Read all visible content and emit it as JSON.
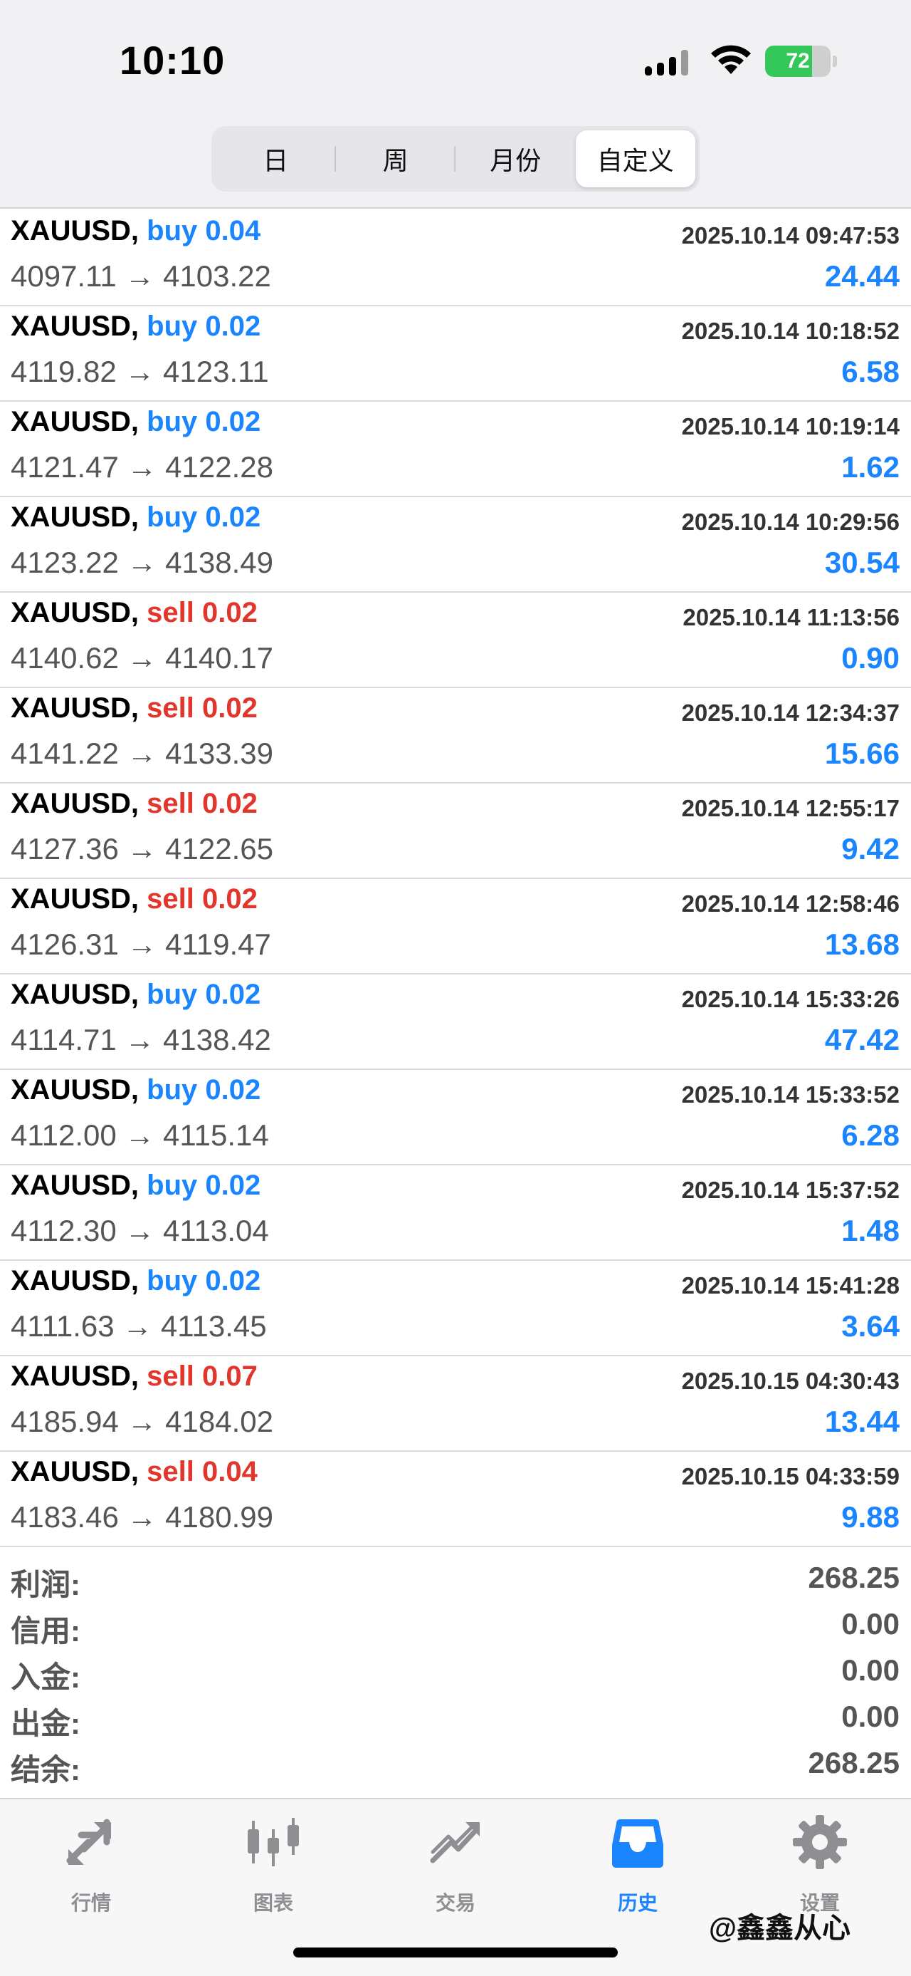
{
  "status": {
    "time": "10:10",
    "battery": "72",
    "battery_level": 0.72
  },
  "segments": [
    {
      "label": "日",
      "active": false
    },
    {
      "label": "周",
      "active": false
    },
    {
      "label": "月份",
      "active": false
    },
    {
      "label": "自定义",
      "active": true
    }
  ],
  "trades": [
    {
      "symbol": "XAUUSD,",
      "side": "buy",
      "volume": "0.04",
      "prices": "4097.11 → 4103.22",
      "datetime": "2025.10.14 09:47:53",
      "profit": "24.44"
    },
    {
      "symbol": "XAUUSD,",
      "side": "buy",
      "volume": "0.02",
      "prices": "4119.82 → 4123.11",
      "datetime": "2025.10.14 10:18:52",
      "profit": "6.58"
    },
    {
      "symbol": "XAUUSD,",
      "side": "buy",
      "volume": "0.02",
      "prices": "4121.47 → 4122.28",
      "datetime": "2025.10.14 10:19:14",
      "profit": "1.62"
    },
    {
      "symbol": "XAUUSD,",
      "side": "buy",
      "volume": "0.02",
      "prices": "4123.22 → 4138.49",
      "datetime": "2025.10.14 10:29:56",
      "profit": "30.54"
    },
    {
      "symbol": "XAUUSD,",
      "side": "sell",
      "volume": "0.02",
      "prices": "4140.62 → 4140.17",
      "datetime": "2025.10.14 11:13:56",
      "profit": "0.90"
    },
    {
      "symbol": "XAUUSD,",
      "side": "sell",
      "volume": "0.02",
      "prices": "4141.22 → 4133.39",
      "datetime": "2025.10.14 12:34:37",
      "profit": "15.66"
    },
    {
      "symbol": "XAUUSD,",
      "side": "sell",
      "volume": "0.02",
      "prices": "4127.36 → 4122.65",
      "datetime": "2025.10.14 12:55:17",
      "profit": "9.42"
    },
    {
      "symbol": "XAUUSD,",
      "side": "sell",
      "volume": "0.02",
      "prices": "4126.31 → 4119.47",
      "datetime": "2025.10.14 12:58:46",
      "profit": "13.68"
    },
    {
      "symbol": "XAUUSD,",
      "side": "buy",
      "volume": "0.02",
      "prices": "4114.71 → 4138.42",
      "datetime": "2025.10.14 15:33:26",
      "profit": "47.42"
    },
    {
      "symbol": "XAUUSD,",
      "side": "buy",
      "volume": "0.02",
      "prices": "4112.00 → 4115.14",
      "datetime": "2025.10.14 15:33:52",
      "profit": "6.28"
    },
    {
      "symbol": "XAUUSD,",
      "side": "buy",
      "volume": "0.02",
      "prices": "4112.30 → 4113.04",
      "datetime": "2025.10.14 15:37:52",
      "profit": "1.48"
    },
    {
      "symbol": "XAUUSD,",
      "side": "buy",
      "volume": "0.02",
      "prices": "4111.63 → 4113.45",
      "datetime": "2025.10.14 15:41:28",
      "profit": "3.64"
    },
    {
      "symbol": "XAUUSD,",
      "side": "sell",
      "volume": "0.07",
      "prices": "4185.94 → 4184.02",
      "datetime": "2025.10.15 04:30:43",
      "profit": "13.44"
    },
    {
      "symbol": "XAUUSD,",
      "side": "sell",
      "volume": "0.04",
      "prices": "4183.46 → 4180.99",
      "datetime": "2025.10.15 04:33:59",
      "profit": "9.88"
    }
  ],
  "summary": [
    {
      "label": "利润:",
      "value": "268.25"
    },
    {
      "label": "信用:",
      "value": "0.00"
    },
    {
      "label": "入金:",
      "value": "0.00"
    },
    {
      "label": "出金:",
      "value": "0.00"
    },
    {
      "label": "结余:",
      "value": "268.25"
    }
  ],
  "tabs": [
    {
      "label": "行情",
      "icon": "quotes-icon",
      "active": false
    },
    {
      "label": "图表",
      "icon": "chart-icon",
      "active": false
    },
    {
      "label": "交易",
      "icon": "trade-icon",
      "active": false
    },
    {
      "label": "历史",
      "icon": "history-icon",
      "active": true
    },
    {
      "label": "设置",
      "icon": "gear-icon",
      "active": false
    }
  ],
  "watermark": "@鑫鑫从心",
  "colors": {
    "accent": "#1b84ff",
    "sell": "#e2362c",
    "inactive": "#8e8e93"
  }
}
